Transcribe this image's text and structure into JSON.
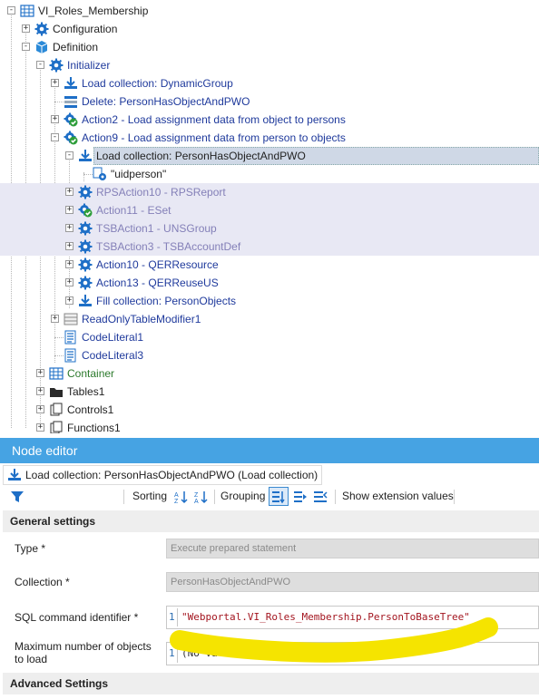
{
  "tree": {
    "items": [
      {
        "label": "VI_Roles_Membership",
        "color": "black",
        "icon": "table-grid-icon"
      },
      {
        "label": "Configuration",
        "color": "black",
        "icon": "gear-icon"
      },
      {
        "label": "Definition",
        "color": "black",
        "icon": "cube-icon"
      },
      {
        "label": "Initializer",
        "color": "blue",
        "icon": "gear-icon"
      },
      {
        "label": "Load collection: DynamicGroup",
        "color": "blue",
        "icon": "download-icon"
      },
      {
        "label": "Delete: PersonHasObjectAndPWO",
        "color": "blue",
        "icon": "delete-rows-icon"
      },
      {
        "label": "Action2 - Load assignment data from object to persons",
        "color": "blue",
        "icon": "gear-check-icon"
      },
      {
        "label": "Action9 - Load assignment data from person to objects",
        "color": "blue",
        "icon": "gear-check-icon"
      },
      {
        "label": "Load collection: PersonHasObjectAndPWO",
        "color": "black",
        "icon": "download-icon"
      },
      {
        "label": "\"uidperson\"",
        "color": "black",
        "icon": "gear-small-icon"
      },
      {
        "label": "RPSAction10 - RPSReport",
        "color": "grey",
        "icon": "gear-icon"
      },
      {
        "label": "Action11 - ESet",
        "color": "grey",
        "icon": "gear-check-icon"
      },
      {
        "label": "TSBAction1 - UNSGroup",
        "color": "grey",
        "icon": "gear-icon"
      },
      {
        "label": "TSBAction3 - TSBAccountDef",
        "color": "grey",
        "icon": "gear-icon"
      },
      {
        "label": "Action10 - QERResource",
        "color": "blue",
        "icon": "gear-icon"
      },
      {
        "label": "Action13 - QERReuseUS",
        "color": "blue",
        "icon": "gear-icon"
      },
      {
        "label": "Fill collection: PersonObjects",
        "color": "blue",
        "icon": "download-icon"
      },
      {
        "label": "ReadOnlyTableModifier1",
        "color": "blue",
        "icon": "table-lock-icon"
      },
      {
        "label": "CodeLiteral1",
        "color": "blue",
        "icon": "code-literal-icon"
      },
      {
        "label": "CodeLiteral3",
        "color": "blue",
        "icon": "code-literal-icon"
      },
      {
        "label": "Container",
        "color": "green",
        "icon": "table-grid-icon"
      },
      {
        "label": "Tables1",
        "color": "black",
        "icon": "folder-icon"
      },
      {
        "label": "Controls1",
        "color": "black",
        "icon": "controls-icon"
      },
      {
        "label": "Functions1",
        "color": "black",
        "icon": "functions-icon"
      }
    ]
  },
  "colors": {
    "accent": "#46a3e3",
    "link_blue": "#1f3a9c",
    "disabled_grey": "#8480b8",
    "green": "#2c7a2c",
    "highlight_band": "#e8e8f4",
    "selection": "#cfd8e6",
    "marker": "#f5e400"
  },
  "node_editor": {
    "title": "Node editor",
    "node_header": "Load collection: PersonHasObjectAndPWO (Load collection)",
    "toolbar": {
      "sorting": "Sorting",
      "grouping": "Grouping",
      "show_extension": "Show extension values"
    },
    "general_settings": "General settings",
    "fields": {
      "type_label": "Type *",
      "type_value": "Execute prepared statement",
      "collection_label": "Collection *",
      "collection_value": "PersonHasObjectAndPWO",
      "sql_label": "SQL command identifier *",
      "sql_line": "1",
      "sql_value": "\"Webportal.VI_Roles_Membership.PersonToBaseTree\"",
      "max_label_1": "Maximum number of objects",
      "max_label_2": "to load",
      "max_line": "1",
      "max_value": "(No value assigned)"
    },
    "advanced_settings": "Advanced Settings"
  }
}
